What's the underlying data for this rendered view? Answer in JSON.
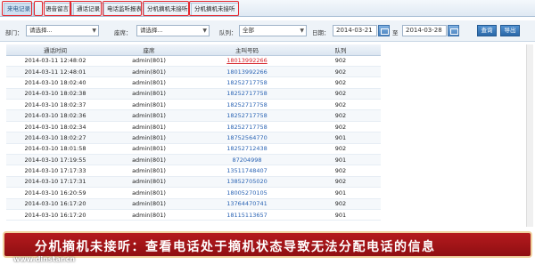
{
  "tabs": [
    {
      "label": "来电记录"
    },
    {
      "label": "语音留言"
    },
    {
      "label": "通话记录"
    },
    {
      "label": "电话监听报表"
    },
    {
      "label": "分机摘机未接听"
    },
    {
      "label": "分机摘机未接听"
    }
  ],
  "filter": {
    "dept_label": "部门：",
    "dept_value": "请选择...",
    "seat_label": "座席：",
    "seat_value": "请选择...",
    "queue_label": "队列：",
    "queue_value": "全部",
    "date_label": "日期：",
    "date_from": "2014-03-21",
    "date_sep": "至",
    "date_to": "2014-03-28",
    "query_button": "查询",
    "export_button": "导出"
  },
  "table": {
    "headers": [
      "通话时间",
      "座席",
      "主叫号码",
      "队列"
    ],
    "rows": [
      [
        "2014-03-11 12:48:02",
        "admin(801)",
        "18013992266",
        "902"
      ],
      [
        "2014-03-11 12:48:01",
        "admin(801)",
        "18013992266",
        "902"
      ],
      [
        "2014-03-10 18:02:40",
        "admin(801)",
        "18252717758",
        "902"
      ],
      [
        "2014-03-10 18:02:38",
        "admin(801)",
        "18252717758",
        "902"
      ],
      [
        "2014-03-10 18:02:37",
        "admin(801)",
        "18252717758",
        "902"
      ],
      [
        "2014-03-10 18:02:36",
        "admin(801)",
        "18252717758",
        "902"
      ],
      [
        "2014-03-10 18:02:34",
        "admin(801)",
        "18252717758",
        "902"
      ],
      [
        "2014-03-10 18:02:27",
        "admin(801)",
        "18752564770",
        "901"
      ],
      [
        "2014-03-10 18:01:58",
        "admin(801)",
        "18252712438",
        "902"
      ],
      [
        "2014-03-10 17:19:55",
        "admin(801)",
        "87204998",
        "901"
      ],
      [
        "2014-03-10 17:17:33",
        "admin(801)",
        "13511748407",
        "902"
      ],
      [
        "2014-03-10 17:17:31",
        "admin(801)",
        "13852705020",
        "902"
      ],
      [
        "2014-03-10 16:20:59",
        "admin(801)",
        "18005270105",
        "901"
      ],
      [
        "2014-03-10 16:17:20",
        "admin(801)",
        "13764470741",
        "902"
      ],
      [
        "2014-03-10 16:17:20",
        "admin(801)",
        "18115113657",
        "901"
      ]
    ]
  },
  "banner": {
    "text": "分机摘机未接听：查看电话处于摘机状态导致无法分配电话的信息",
    "watermark": "www.dinstar.cn"
  },
  "colors": {
    "highlight_box": "#e5262d",
    "banner_bg": "#a8161a",
    "link_blue": "#2b64b4"
  }
}
